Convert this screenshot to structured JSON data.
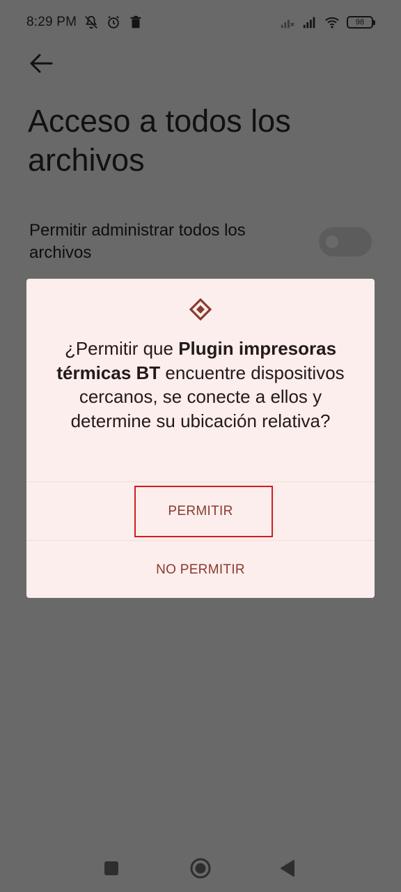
{
  "status_bar": {
    "time": "8:29 PM",
    "battery": "98",
    "icons_left": [
      "mute-icon",
      "alarm-icon",
      "trash-icon"
    ],
    "icons_right": [
      "signal-off-icon",
      "signal-icon",
      "wifi-icon",
      "battery-icon"
    ]
  },
  "page": {
    "back_icon": "back-arrow-icon",
    "title": "Acceso a todos los archivos",
    "setting_label": "Permitir administrar todos los archivos",
    "toggle_state": "off"
  },
  "dialog": {
    "icon": "app-diamond-icon",
    "message_prefix": "¿Permitir que ",
    "app_name": "Plugin impresoras térmicas BT",
    "message_suffix": " encuentre dispositivos cercanos, se conecte a ellos y determine su ubicación relativa?",
    "allow_label": "PERMITIR",
    "deny_label": "NO PERMITIR"
  },
  "colors": {
    "dim_background": "#696969",
    "dialog_background": "#fbeeec",
    "button_text": "#8b3a2e",
    "highlight": "#d31d1d"
  },
  "nav_bar": {
    "items": [
      "recents-icon",
      "home-icon",
      "back-icon"
    ]
  }
}
